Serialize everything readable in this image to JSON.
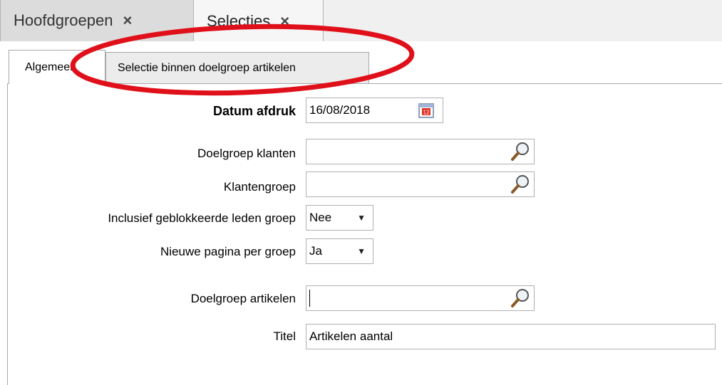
{
  "doc_tabs": [
    {
      "label": "Hoofdgroepen",
      "close": "×"
    },
    {
      "label": "Selecties",
      "close": "×"
    }
  ],
  "inner_tabs": [
    {
      "label": "Algemeen"
    },
    {
      "label": "Selectie binnen doelgroep artikelen"
    }
  ],
  "form": {
    "datum_afdruk": {
      "label": "Datum afdruk",
      "value": "16/08/2018"
    },
    "doelgroep_klanten": {
      "label": "Doelgroep klanten",
      "value": ""
    },
    "klantengroep": {
      "label": "Klantengroep",
      "value": ""
    },
    "inclusief_geblokkeerde": {
      "label": "Inclusief geblokkeerde leden groep",
      "value": "Nee"
    },
    "nieuwe_pagina": {
      "label": "Nieuwe pagina per groep",
      "value": "Ja"
    },
    "doelgroep_artikelen": {
      "label": "Doelgroep artikelen",
      "value": ""
    },
    "titel": {
      "label": "Titel",
      "value": "Artikelen aantal"
    }
  },
  "colors": {
    "highlight": "#e0101a"
  }
}
